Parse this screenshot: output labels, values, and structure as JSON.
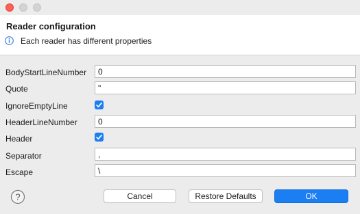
{
  "window": {
    "title": ""
  },
  "header": {
    "title": "Reader configuration",
    "message": "Each reader has different properties",
    "info_icon": "info-icon"
  },
  "properties": [
    {
      "label": "BodyStartLineNumber",
      "type": "text",
      "value": "0"
    },
    {
      "label": "Quote",
      "type": "text",
      "value": "\""
    },
    {
      "label": "IgnoreEmptyLine",
      "type": "checkbox",
      "checked": true
    },
    {
      "label": "HeaderLineNumber",
      "type": "text",
      "value": "0"
    },
    {
      "label": "Header",
      "type": "checkbox",
      "checked": true
    },
    {
      "label": "Separator",
      "type": "text",
      "value": ","
    },
    {
      "label": "Escape",
      "type": "text",
      "value": "\\"
    }
  ],
  "footer": {
    "help_icon": "help-icon",
    "cancel_label": "Cancel",
    "restore_label": "Restore Defaults",
    "ok_label": "OK"
  },
  "colors": {
    "accent": "#1b7ef2",
    "close_light": "#ff5f57"
  }
}
